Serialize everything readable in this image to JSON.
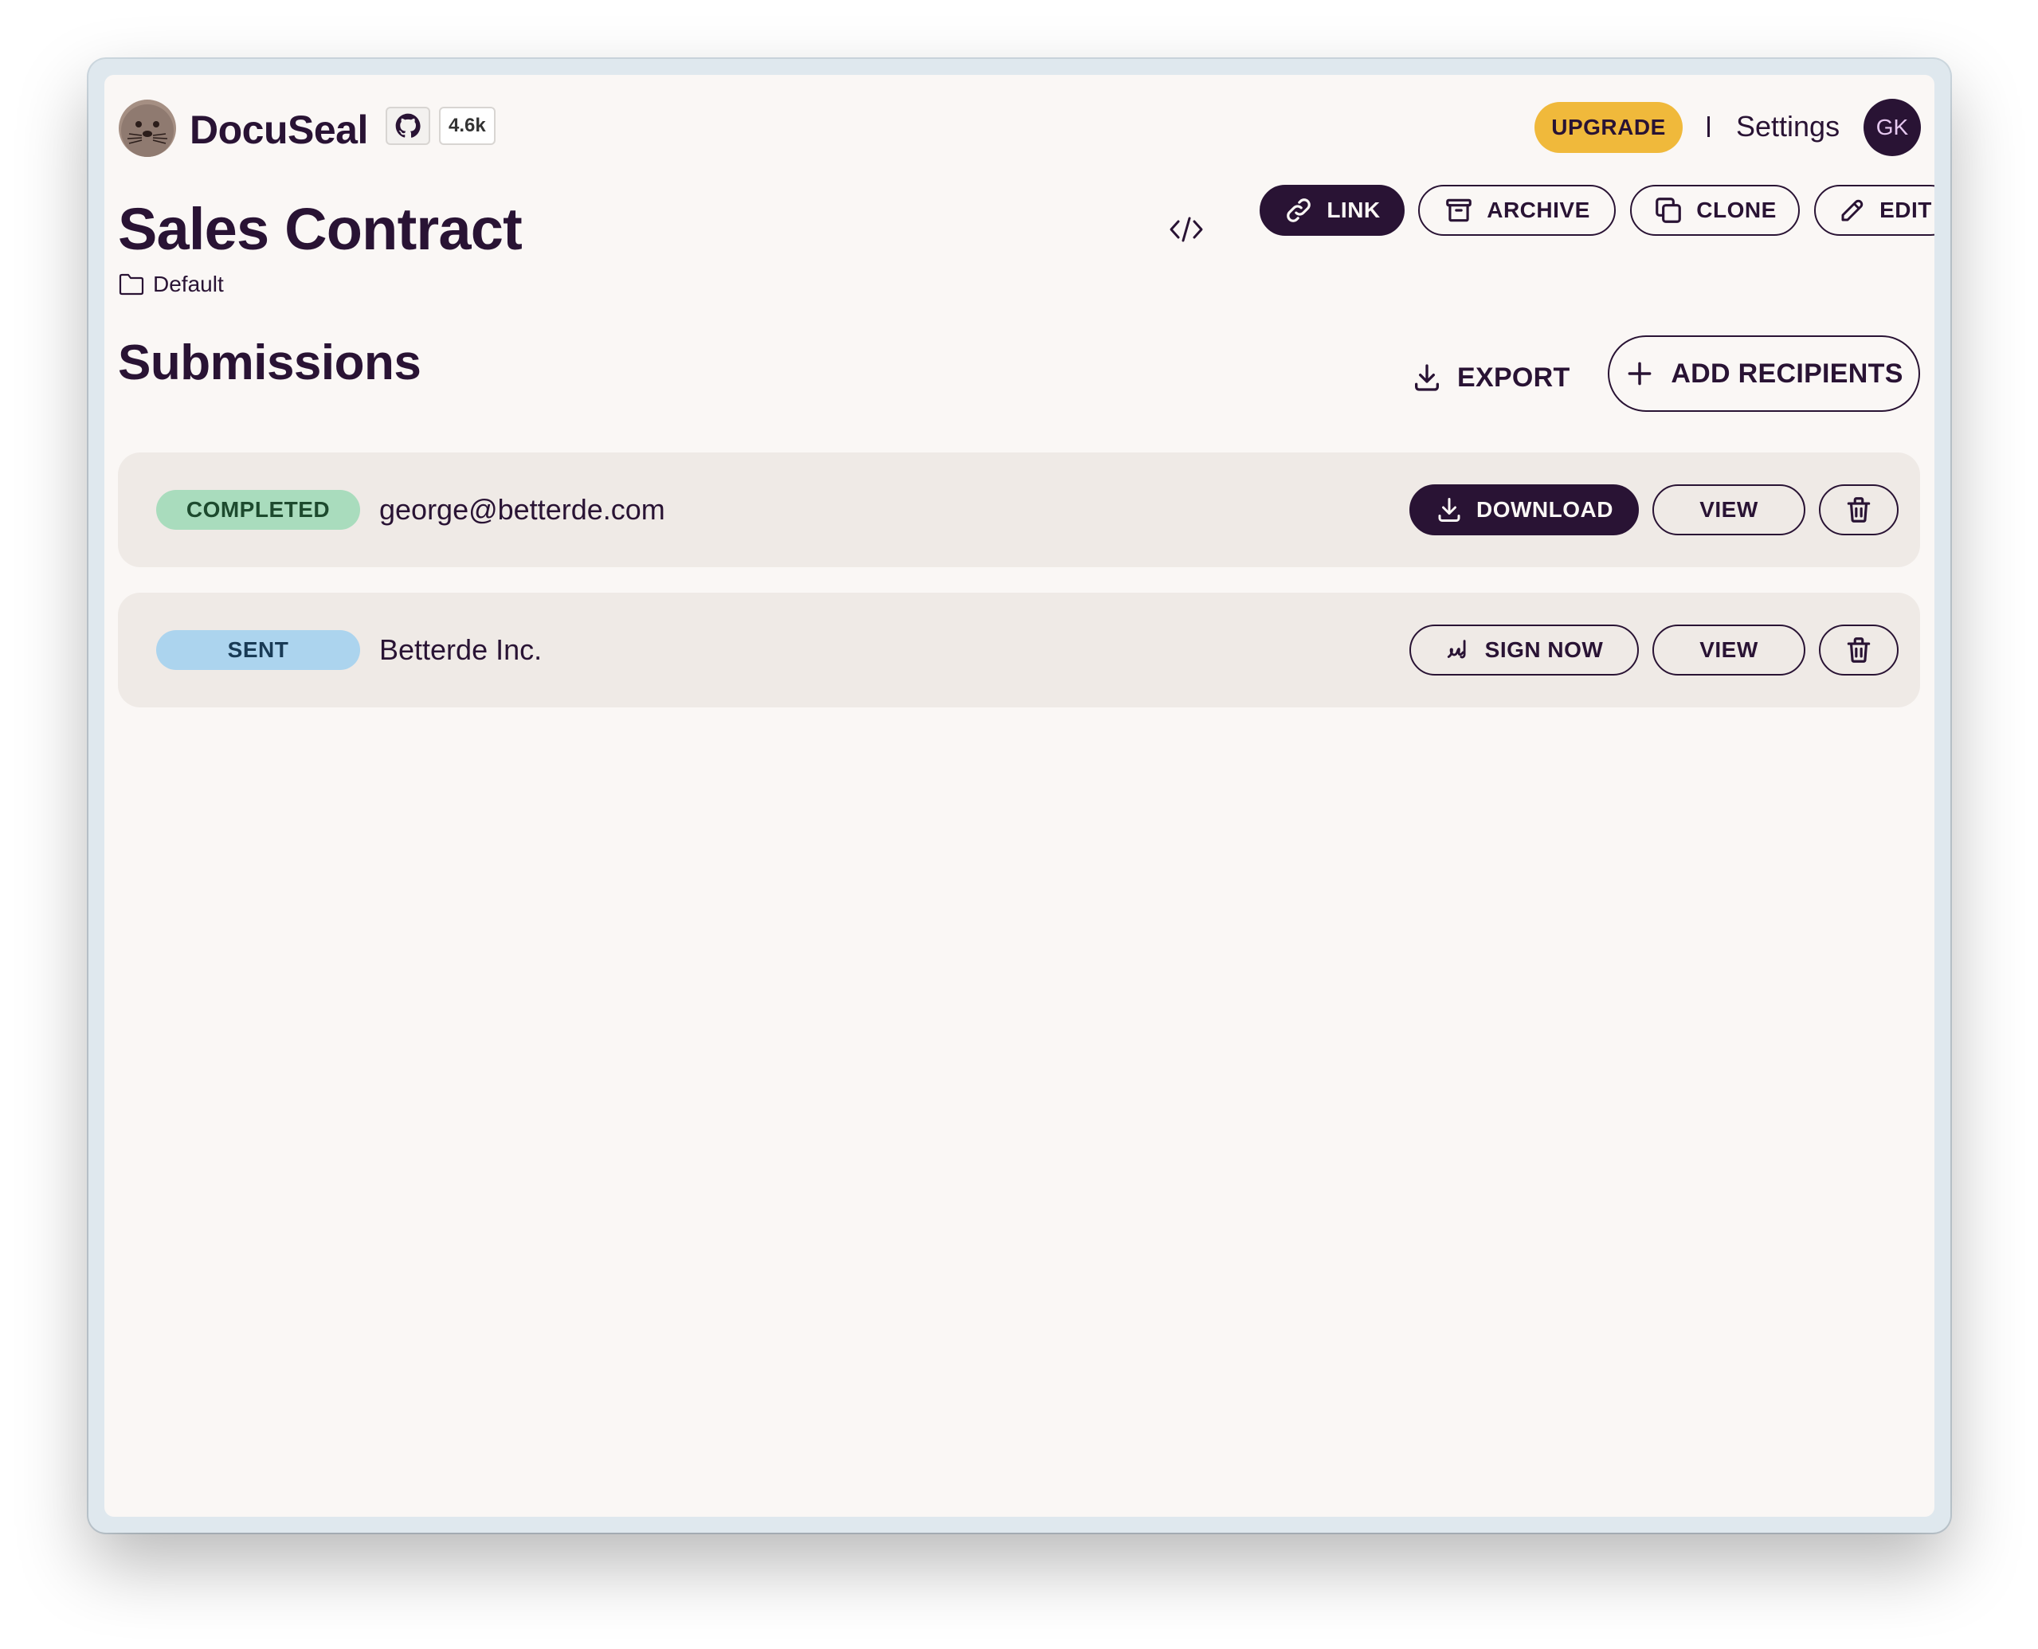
{
  "app": {
    "brand": "DocuSeal",
    "github_stars": "4.6k",
    "upgrade_label": "UPGRADE",
    "settings_label": "Settings",
    "avatar_initials": "GK"
  },
  "template": {
    "title": "Sales Contract",
    "folder": "Default",
    "actions": {
      "link": "LINK",
      "archive": "ARCHIVE",
      "clone": "CLONE",
      "edit": "EDIT"
    }
  },
  "submissions": {
    "heading": "Submissions",
    "export_label": "EXPORT",
    "add_recipients_label": "ADD RECIPIENTS",
    "rows": [
      {
        "status": "COMPLETED",
        "recipient": "george@betterde.com",
        "primary_action": "DOWNLOAD",
        "view_label": "VIEW"
      },
      {
        "status": "SENT",
        "recipient": "Betterde Inc.",
        "primary_action": "SIGN NOW",
        "view_label": "VIEW"
      }
    ]
  },
  "colors": {
    "primary": "#291334",
    "background": "#faf7f5",
    "upgrade": "#f0b93b",
    "completed_badge": "#a9dcbd",
    "sent_badge": "#acd4ee",
    "row_background": "#efeae6"
  },
  "icons": [
    "seal-logo",
    "github-icon",
    "code-icon",
    "link-icon",
    "archive-icon",
    "clone-icon",
    "pencil-icon",
    "folder-icon",
    "download-icon",
    "plus-icon",
    "signature-icon",
    "trash-icon"
  ]
}
